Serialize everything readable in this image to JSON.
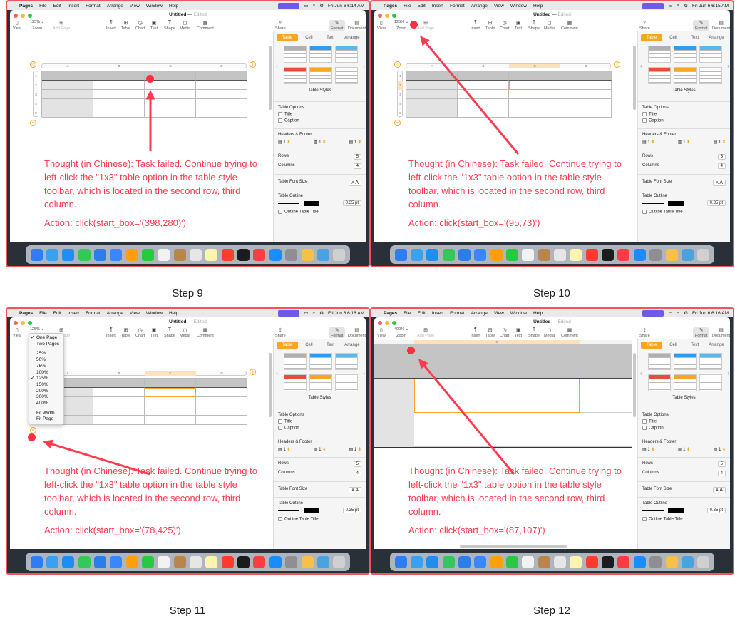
{
  "menubar": {
    "apple": "",
    "app": "Pages",
    "items": [
      "File",
      "Edit",
      "Insert",
      "Format",
      "Arrange",
      "View",
      "Window",
      "Help"
    ]
  },
  "document": {
    "name": "Untitled",
    "status": "Edited"
  },
  "toolbar_left": [
    {
      "label": "View",
      "icon": "sidebar-icon"
    },
    {
      "label": "Zoom",
      "icon": "zoom-icon"
    },
    {
      "label": "Add Page",
      "icon": "add-page-icon"
    }
  ],
  "toolbar_mid": [
    {
      "label": "Insert",
      "icon": "insert-icon"
    },
    {
      "label": "Table",
      "icon": "table-icon"
    },
    {
      "label": "Chart",
      "icon": "chart-icon"
    },
    {
      "label": "Text",
      "icon": "text-icon"
    },
    {
      "label": "Shape",
      "icon": "shape-icon"
    },
    {
      "label": "Media",
      "icon": "media-icon"
    },
    {
      "label": "Comment",
      "icon": "comment-icon"
    }
  ],
  "toolbar_right": [
    {
      "label": "Share",
      "icon": "share-icon"
    },
    {
      "label": "Format",
      "icon": "format-brush-icon"
    },
    {
      "label": "Document",
      "icon": "document-icon"
    }
  ],
  "sidebar": {
    "tabs": [
      "Table",
      "Cell",
      "Text",
      "Arrange"
    ],
    "table_styles_label": "Table Styles",
    "table_options_label": "Table Options",
    "title_label": "Title",
    "caption_label": "Caption",
    "headers_footer_label": "Headers & Footer",
    "header_values": [
      "1",
      "1",
      "1"
    ],
    "rows_label": "Rows",
    "rows_value": "5",
    "columns_label": "Columns",
    "columns_value": "4",
    "font_size_label": "Table Font Size",
    "font_small": "A",
    "font_large": "A",
    "outline_label": "Table Outline",
    "outline_width": "0.35 pt",
    "outline_title_label": "Outline Table Title"
  },
  "table": {
    "columns": [
      "A",
      "B",
      "C",
      "D"
    ],
    "rows": [
      "1",
      "2",
      "3",
      "4",
      "5"
    ]
  },
  "thought": "Thought (in Chinese): Task failed. Continue trying to left-click the \"1x3\" table option in the table style toolbar, which is located in the second row, third column.",
  "steps": [
    {
      "label": "Step 9",
      "time": "Fri Jun 6  6:14 AM",
      "zoom": "125%",
      "action": "Action: click(start_box='(398,280)')"
    },
    {
      "label": "Step 10",
      "time": "Fri Jun 6  6:15 AM",
      "zoom": "125%",
      "action": "Action: click(start_box='(95,73)')"
    },
    {
      "label": "Step 11",
      "time": "Fri Jun 6  6:16 AM",
      "zoom": "125%",
      "action": "Action: click(start_box='(78,425)')"
    },
    {
      "label": "Step 12",
      "time": "Fri Jun 6  6:16 AM",
      "zoom": "400%",
      "action": "Action: click(start_box='(87,107)')"
    }
  ],
  "zoom_menu": [
    "One Page",
    "Two Pages",
    "25%",
    "50%",
    "75%",
    "100%",
    "125%",
    "150%",
    "200%",
    "300%",
    "400%",
    "Fit Width",
    "Fit Page"
  ],
  "zoom_menu_checked": [
    "One Page",
    "125%"
  ],
  "colors": {
    "annotation": "#ff3b4f",
    "accent": "#f7a623",
    "frame": "#f0545f"
  }
}
